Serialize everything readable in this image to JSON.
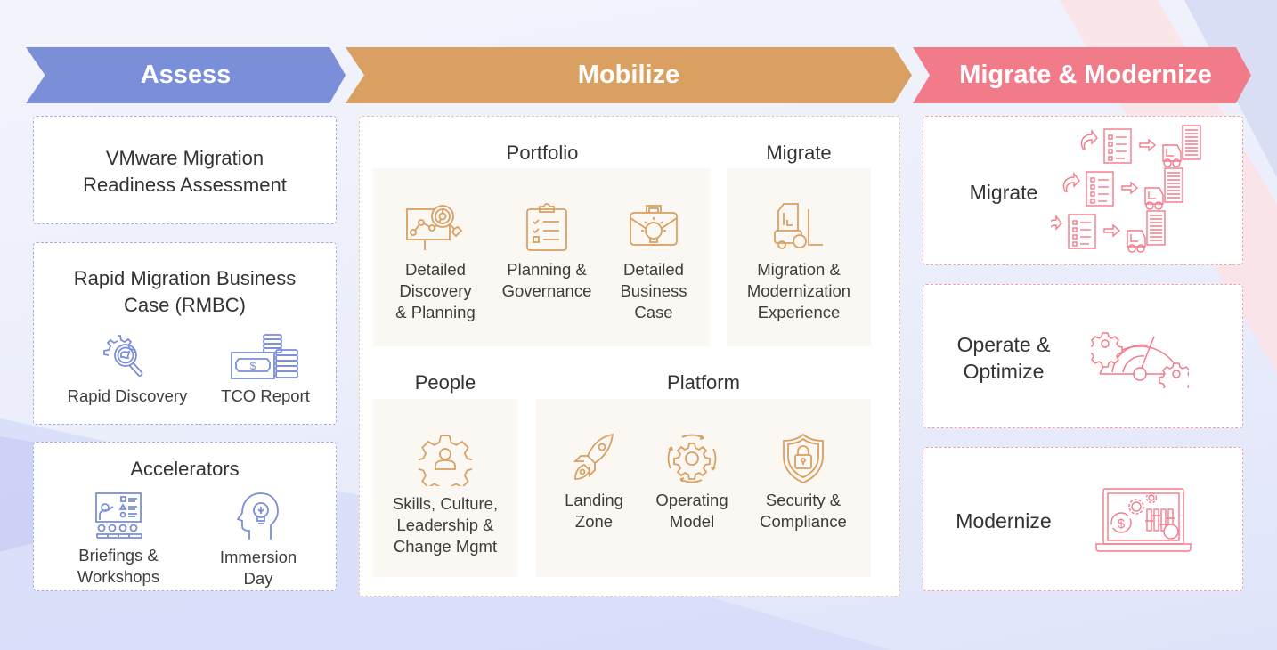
{
  "phases": [
    {
      "label": "Assess",
      "color": "#7b8ed8"
    },
    {
      "label": "Mobilize",
      "color": "#d9a062"
    },
    {
      "label": "Migrate & Modernize",
      "color": "#f27b8a"
    }
  ],
  "assess": {
    "readiness": {
      "line1": "VMware Migration",
      "line2": "Readiness Assessment"
    },
    "rmbc": {
      "line1": "Rapid Migration Business",
      "line2": "Case (RMBC)",
      "items": [
        {
          "label": "Rapid Discovery",
          "icon": "gear-magnifier-icon"
        },
        {
          "label": "TCO Report",
          "icon": "money-coins-icon"
        }
      ]
    },
    "accelerators": {
      "title": "Accelerators",
      "items": [
        {
          "line1": "Briefings &",
          "line2": "Workshops",
          "icon": "presentation-audience-icon"
        },
        {
          "line1": "Immersion",
          "line2": "Day",
          "icon": "head-lightbulb-icon"
        }
      ]
    }
  },
  "mobilize": {
    "portfolio": {
      "title": "Portfolio",
      "items": [
        {
          "lines": [
            "Detailed",
            "Discovery",
            "& Planning"
          ],
          "icon": "chart-magnifier-icon"
        },
        {
          "lines": [
            "Planning &",
            "Governance"
          ],
          "icon": "clipboard-checklist-icon"
        },
        {
          "lines": [
            "Detailed",
            "Business",
            "Case"
          ],
          "icon": "briefcase-lightbulb-icon"
        }
      ]
    },
    "migrate": {
      "title": "Migrate",
      "items": [
        {
          "lines": [
            "Migration &",
            "Modernization",
            "Experience"
          ],
          "icon": "forklift-icon"
        }
      ]
    },
    "people": {
      "title": "People",
      "items": [
        {
          "lines": [
            "Skills, Culture,",
            "Leadership &",
            "Change Mgmt"
          ],
          "icon": "gear-person-icon"
        }
      ]
    },
    "platform": {
      "title": "Platform",
      "items": [
        {
          "lines": [
            "Landing",
            "Zone"
          ],
          "icon": "rocket-icon"
        },
        {
          "lines": [
            "Operating",
            "Model"
          ],
          "icon": "gear-cycle-icon"
        },
        {
          "lines": [
            "Security &",
            "Compliance"
          ],
          "icon": "shield-lock-icon"
        }
      ]
    }
  },
  "migrate_modernize": {
    "items": [
      {
        "lines": [
          "Migrate"
        ],
        "icon": "migration-flow-icon"
      },
      {
        "lines": [
          "Operate &",
          "Optimize"
        ],
        "icon": "gauge-gears-icon"
      },
      {
        "lines": [
          "Modernize"
        ],
        "icon": "laptop-dashboard-icon"
      }
    ]
  }
}
